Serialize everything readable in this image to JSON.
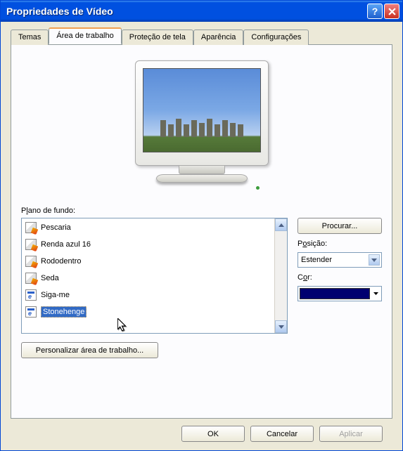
{
  "window": {
    "title": "Propriedades de Vídeo"
  },
  "tabs": {
    "themes": "Temas",
    "desktop": "Área de trabalho",
    "screensaver": "Proteção de tela",
    "appearance": "Aparência",
    "settings": "Configurações"
  },
  "background": {
    "label_pre": "P",
    "label_ul": "l",
    "label_post": "ano de fundo:",
    "items": [
      {
        "name": "Pescaria",
        "icon": "paint"
      },
      {
        "name": "Renda azul 16",
        "icon": "paint"
      },
      {
        "name": "Rododentro",
        "icon": "paint"
      },
      {
        "name": "Seda",
        "icon": "paint"
      },
      {
        "name": "Siga-me",
        "icon": "html"
      },
      {
        "name": "Stonehenge",
        "icon": "html",
        "selected": true
      }
    ]
  },
  "browse_pre": "P",
  "browse_ul": "r",
  "browse_post": "ocurar...",
  "position_label_pre": "P",
  "position_label_ul": "o",
  "position_label_post": "sição:",
  "position_value": "Estender",
  "color_label_pre": "C",
  "color_label_ul": "o",
  "color_label_post": "r:",
  "color_value": "#000070",
  "customize_label": "Personalizar área de trabalho...",
  "buttons": {
    "ok": "OK",
    "cancel": "Cancelar",
    "apply": "Aplicar"
  }
}
